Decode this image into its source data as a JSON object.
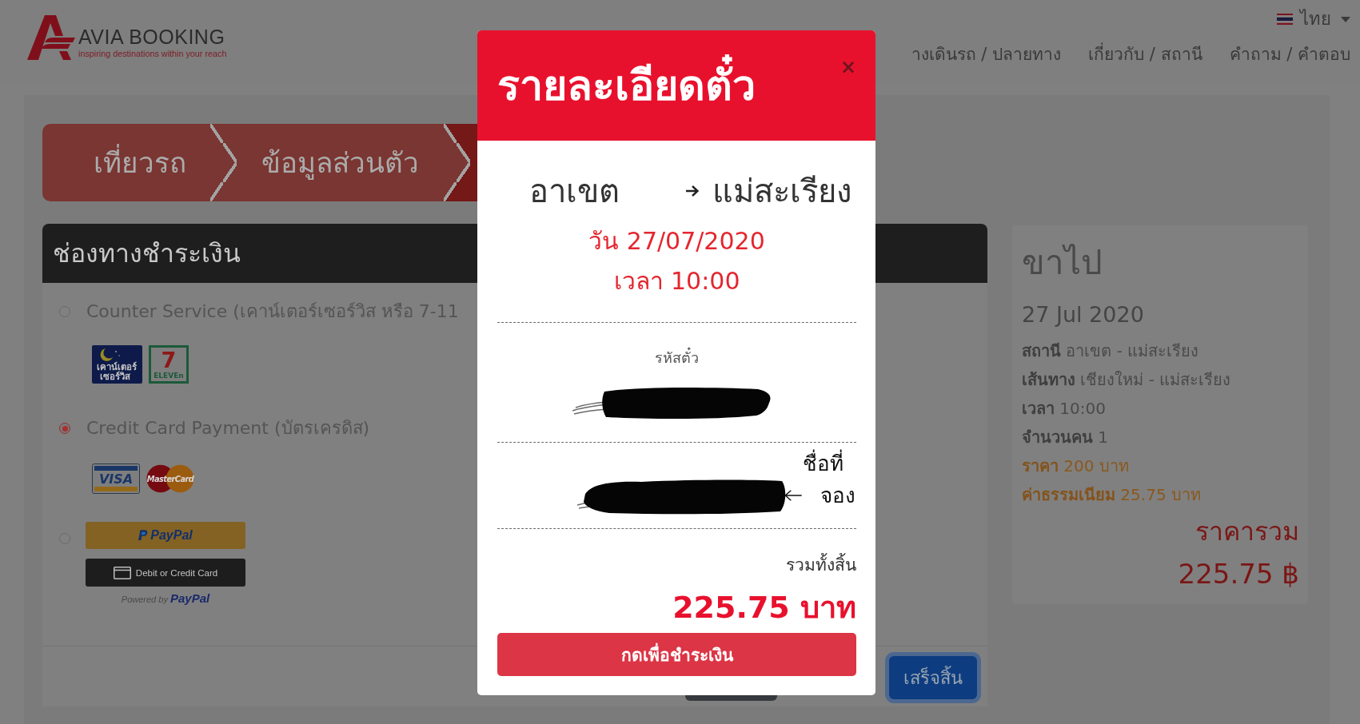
{
  "header": {
    "logo": {
      "name": "AVIA BOOKING",
      "tagline": "inspiring destinations within your reach"
    },
    "language": "ไทย",
    "nav": [
      "างเดินรถ / ปลายทาง",
      "เกี่ยวกับ / สถานี",
      "คำถาม / คำตอบ"
    ]
  },
  "steps": [
    {
      "label": "เที่ยวรถ",
      "selected": false
    },
    {
      "label": "ข้อมูลส่วนตัว",
      "selected": false
    },
    {
      "selected": true
    }
  ],
  "payment": {
    "title": "ช่องทางชำระเงิน",
    "options": [
      {
        "kind": "counter",
        "label": "Counter Service (เคาน์เตอร์เซอร์วิส หรือ 7-11",
        "selected": false,
        "logos": [
          {
            "kind": "counter_service",
            "lines": [
              "เคาน์เตอร์",
              "เซอร์วิส"
            ]
          },
          {
            "kind": "seven_eleven",
            "numeral": "7",
            "text": "ELEVEn"
          }
        ]
      },
      {
        "kind": "card",
        "label": "Credit Card Payment (บัตรเครดิส)",
        "selected": true,
        "logos": [
          {
            "kind": "visa",
            "text": "VISA"
          },
          {
            "kind": "mastercard",
            "text": "MasterCard"
          }
        ]
      },
      {
        "kind": "paypal",
        "selected": false,
        "paypal_button": "PayPal",
        "card_button": "Debit or Credit Card",
        "powered_by": "Powered by **PayPal**"
      }
    ],
    "done_button": "เสร็จสิ้น"
  },
  "summary": {
    "title": "ขาไป",
    "date": "27 Jul 2020",
    "rows": [
      {
        "kind": "info",
        "label": "สถานี",
        "value": "อาเขต - แม่สะเรียง"
      },
      {
        "kind": "info",
        "label": "เส้นทาง",
        "value": "เชียงใหม่ - แม่สะเรียง"
      },
      {
        "kind": "info",
        "label": "เวลา",
        "value": "10:00"
      },
      {
        "kind": "info",
        "label": "จำนวนคน",
        "value": "1"
      },
      {
        "kind": "price",
        "label": "ราคา",
        "value": "200 บาท"
      },
      {
        "kind": "price",
        "label": "ค่าธรรมเนียม",
        "value": "25.75 บาท"
      }
    ],
    "total_label": "ราคารวม",
    "total": "225.75 ฿"
  },
  "modal": {
    "title": "รายละเอียดตั๋ว",
    "close": "×",
    "from": "อาเขต",
    "to": "แม่สะเรียง",
    "date": "วัน 27/07/2020",
    "time": "เวลา 10:00",
    "code_label": "รหัสตั๋ว",
    "annotation": [
      "ชื่อที่",
      "จอง"
    ],
    "total_label": "รวมทั้งสิ้น",
    "total": "225.75 บาท",
    "pay_button": "กดเพื่อชำระเงิน"
  }
}
